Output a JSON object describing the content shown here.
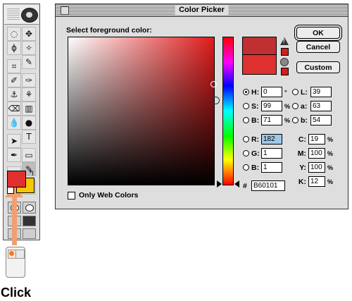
{
  "toolbox": {
    "tools": [
      "marquee-icon",
      "move-icon",
      "lasso-icon",
      "magic-wand-icon",
      "crop-icon",
      "eyedropper-slice-icon",
      "airbrush-icon",
      "paintbrush-icon",
      "stamp-icon",
      "history-brush-icon",
      "eraser-icon",
      "gradient-icon",
      "blur-icon",
      "dodge-icon",
      "path-select-icon",
      "type-icon",
      "pen-icon",
      "shape-icon",
      "notes-icon",
      "eyedropper-icon",
      "hand-icon",
      "zoom-icon"
    ],
    "glyphs": [
      "◌",
      "✥",
      "ϕ",
      "✧",
      "⌗",
      "✎",
      "✐",
      "✑",
      "⚓",
      "⚘",
      "⌫",
      "▥",
      "💧",
      "●",
      "➤",
      "T",
      "✒",
      "▭",
      "▤",
      "✎",
      "✋",
      "🔍"
    ],
    "foreground_color": "#e03030",
    "background_color": "#f5c800"
  },
  "annotation": {
    "label": "Click"
  },
  "dialog": {
    "title": "Color Picker",
    "prompt": "Select foreground color:",
    "buttons": {
      "ok": "OK",
      "cancel": "Cancel",
      "custom": "Custom"
    },
    "hsb": [
      {
        "label": "H:",
        "value": "0",
        "unit": "°",
        "selected": true
      },
      {
        "label": "S:",
        "value": "99",
        "unit": "%",
        "selected": false
      },
      {
        "label": "B:",
        "value": "71",
        "unit": "%",
        "selected": false
      }
    ],
    "rgb": [
      {
        "label": "R:",
        "value": "182",
        "highlighted": true
      },
      {
        "label": "G:",
        "value": "1",
        "highlighted": false
      },
      {
        "label": "B:",
        "value": "1",
        "highlighted": false
      }
    ],
    "lab": [
      {
        "label": "L:",
        "value": "39"
      },
      {
        "label": "a:",
        "value": "63"
      },
      {
        "label": "b:",
        "value": "54"
      }
    ],
    "cmyk": [
      {
        "label": "C:",
        "value": "19",
        "unit": "%"
      },
      {
        "label": "M:",
        "value": "100",
        "unit": "%"
      },
      {
        "label": "Y:",
        "value": "100",
        "unit": "%"
      },
      {
        "label": "K:",
        "value": "12",
        "unit": "%"
      }
    ],
    "hex_label": "#",
    "hex_value": "B60101",
    "web_colors_label": "Only Web Colors",
    "new_color": "#c03030",
    "original_color": "#e03030"
  }
}
